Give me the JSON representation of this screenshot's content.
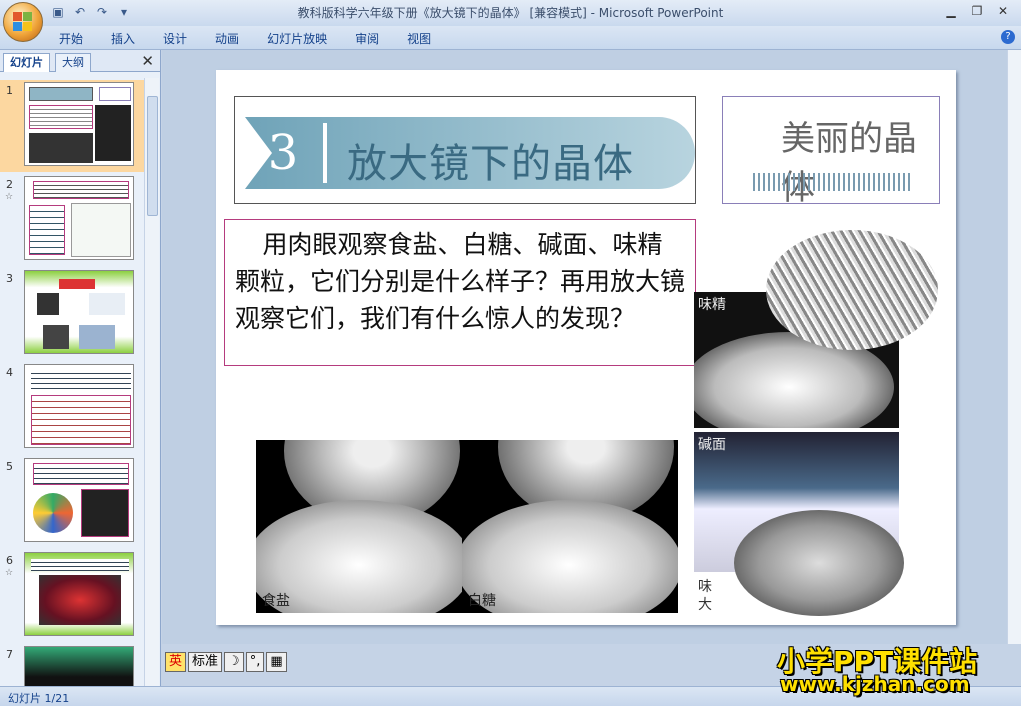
{
  "window": {
    "title": "教科版科学六年级下册《放大镜下的晶体》 [兼容模式] - Microsoft PowerPoint",
    "controls": [
      "▁",
      "❐",
      "✕"
    ]
  },
  "ribbon": {
    "tabs": [
      "开始",
      "插入",
      "设计",
      "动画",
      "幻灯片放映",
      "审阅",
      "视图"
    ],
    "help": "?"
  },
  "panel": {
    "tabs": [
      "幻灯片",
      "大纲"
    ],
    "close": "✕",
    "thumbnails": [
      {
        "number": "1",
        "note": ""
      },
      {
        "number": "2",
        "note": "☆"
      },
      {
        "number": "3",
        "note": ""
      },
      {
        "number": "4",
        "note": ""
      },
      {
        "number": "5",
        "note": ""
      },
      {
        "number": "6",
        "note": "☆"
      },
      {
        "number": "7",
        "note": ""
      }
    ]
  },
  "slide": {
    "title_number": "3",
    "title": "放大镜下的晶体",
    "badge": "美丽的晶体",
    "question": "用肉眼观察食盐、白糖、碱面、味精颗粒，它们分别是什么样子？再用放大镜观察它们，我们有什么惊人的发现？",
    "photos": {
      "salt": "食盐",
      "sugar": "白糖",
      "msg": "味精",
      "soda": "碱面",
      "soda_extra": "味\n大"
    }
  },
  "ime_toolbar": [
    "英",
    "标准",
    "☽",
    "°,",
    "▦"
  ],
  "status": {
    "slide_counter": "幻灯片 1/21"
  },
  "watermark": {
    "line1": "小学PPT课件站",
    "line2": "www.kjzhan.com"
  }
}
